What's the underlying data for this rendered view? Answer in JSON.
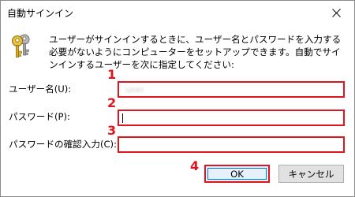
{
  "window": {
    "title": "自動サインイン",
    "close_icon": "close-icon"
  },
  "description": {
    "icon": "keys-icon",
    "text": "ユーザーがサインインするときに、ユーザー名とパスワードを入力する必要がないようにコンピューターをセットアップできます。自動でサインインするユーザーを次に指定してください:"
  },
  "fields": {
    "username": {
      "label": "ユーザー名(U):",
      "value": "user",
      "callout": "1"
    },
    "password": {
      "label": "パスワード(P):",
      "value": "",
      "callout": "2"
    },
    "confirm": {
      "label": "パスワードの確認入力(C):",
      "value": "",
      "callout": "3"
    }
  },
  "buttons": {
    "ok": {
      "label": "OK",
      "callout": "4"
    },
    "cancel": {
      "label": "キャンセル"
    }
  },
  "colors": {
    "highlight": "#e0141e",
    "focus": "#0078d7",
    "button_face": "#e1e1e1"
  }
}
